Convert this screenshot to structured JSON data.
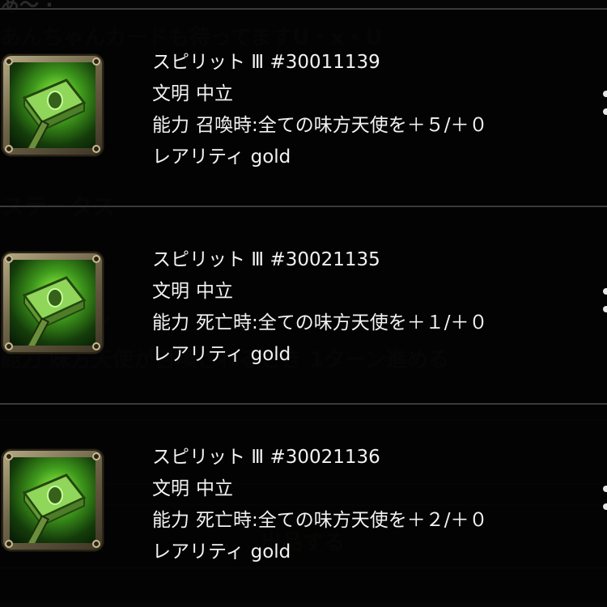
{
  "background": {
    "top_partial": "あ〜 ·",
    "request_text": "あんちゃんカードも待ってますU・x・U",
    "status_heading": "ステータス",
    "skill_label": "ル",
    "ability_text": "能力 味方天使が召喚されるとき 1ターン進める",
    "action_button": "出品する"
  },
  "cards": [
    {
      "name": "スピリット Ⅲ #30011139",
      "civ_label": "文明",
      "civ_value": "中立",
      "ability_label": "能力",
      "ability_value": "召喚時:全ての味方天使を＋５/＋０",
      "rarity_label": "レアリティ",
      "rarity_value": "gold",
      "icon": "green-hammer-icon"
    },
    {
      "name": "スピリット Ⅲ #30021135",
      "civ_label": "文明",
      "civ_value": "中立",
      "ability_label": "能力",
      "ability_value": "死亡時:全ての味方天使を＋１/＋０",
      "rarity_label": "レアリティ",
      "rarity_value": "gold",
      "icon": "green-hammer-icon"
    },
    {
      "name": "スピリット Ⅲ #30021136",
      "civ_label": "文明",
      "civ_value": "中立",
      "ability_label": "能力",
      "ability_value": "死亡時:全ての味方天使を＋２/＋０",
      "rarity_label": "レアリティ",
      "rarity_value": "gold",
      "icon": "green-hammer-icon"
    }
  ],
  "colors": {
    "background": "#050505",
    "text": "#f2f2f2",
    "frame_gold": "#b8ab86",
    "glow_green": "#9dff4a"
  }
}
